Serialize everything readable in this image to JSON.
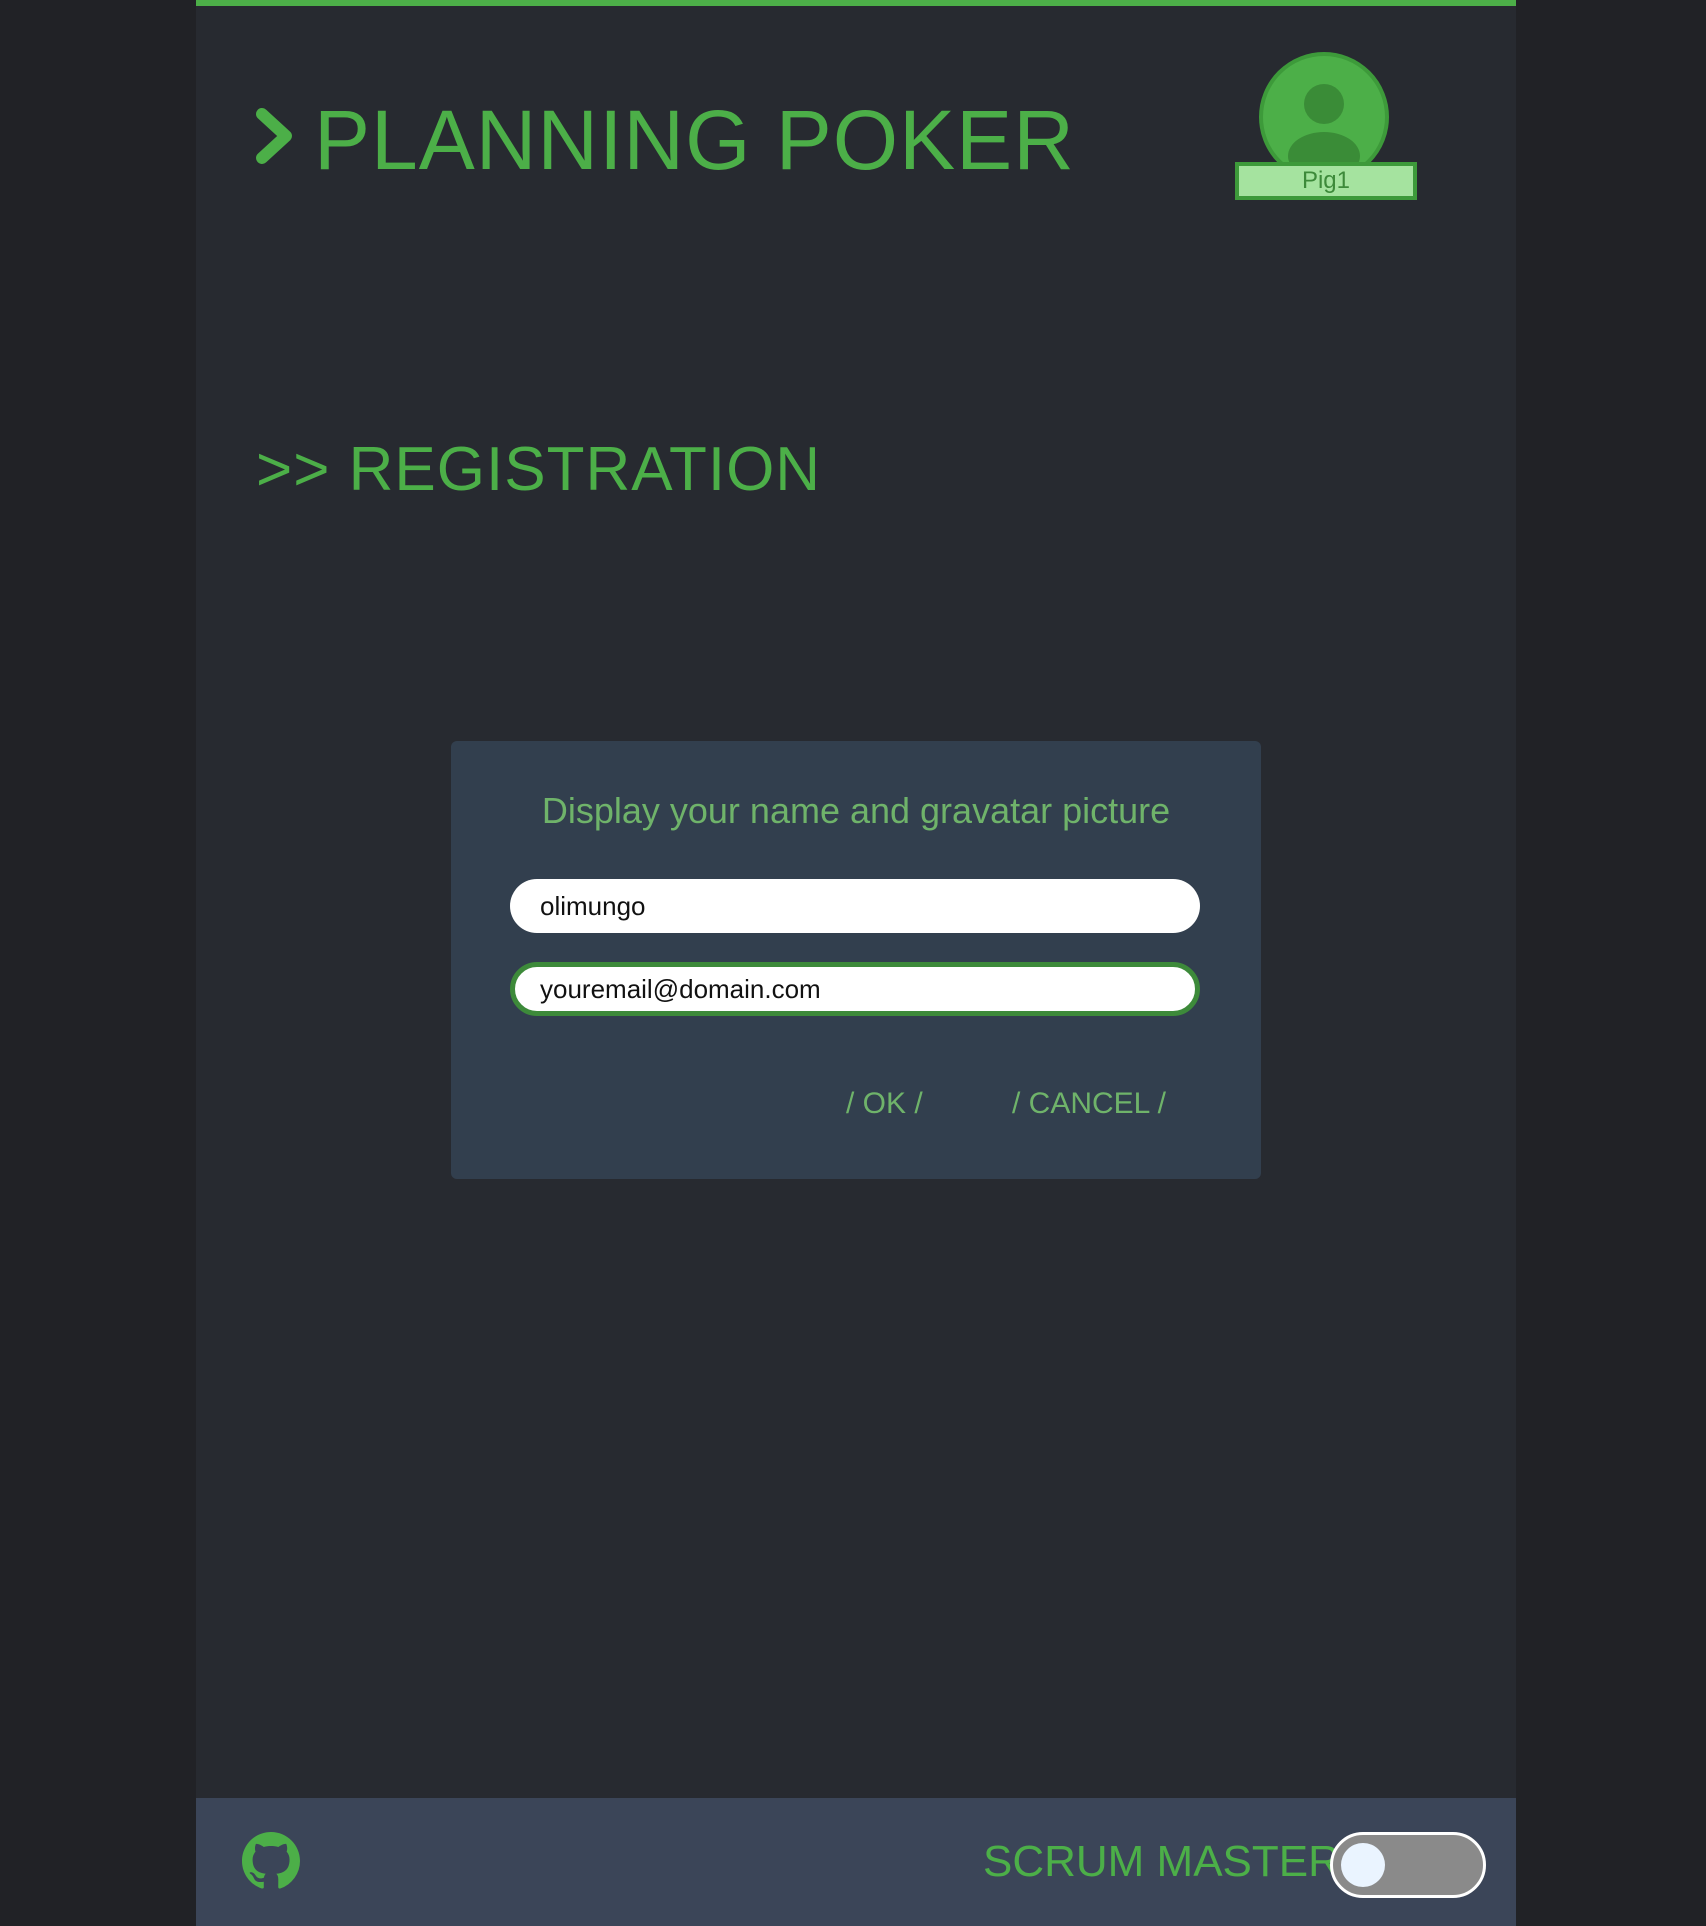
{
  "header": {
    "title": "PLANNING POKER",
    "chevron_icon": "chevron-right-icon",
    "user": {
      "name": "Pig1",
      "avatar_icon": "user-avatar-icon"
    }
  },
  "section": {
    "title": ">> REGISTRATION"
  },
  "dialog": {
    "title": "Display your name and gravatar picture",
    "name_value": "olimungo",
    "email_value": "youremail@domain.com",
    "ok_label": "/ OK /",
    "cancel_label": "/ CANCEL /"
  },
  "footer": {
    "github_icon": "github-icon",
    "scrum_master_label": "SCRUM MASTER",
    "scrum_master_on": false
  },
  "colors": {
    "accent": "#4caf48",
    "background": "#272a30",
    "dialog": "#323f4e",
    "footer": "#3b4558"
  }
}
